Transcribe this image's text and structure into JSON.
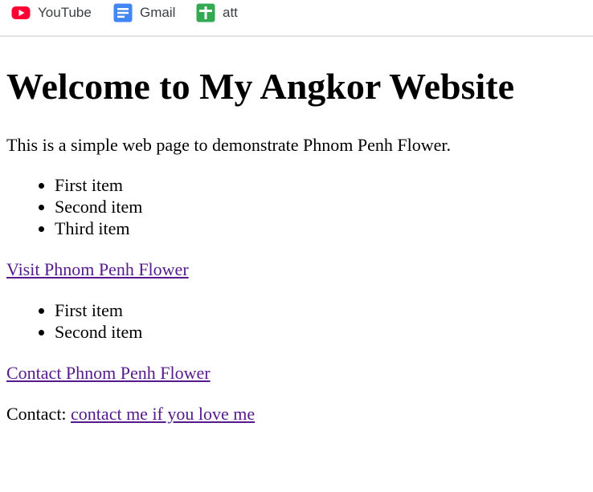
{
  "bookmarks": [
    {
      "label": "YouTube",
      "icon": "youtube-icon",
      "color": "#ff0033"
    },
    {
      "label": "Gmail",
      "icon": "document-icon",
      "color": "#4285f4"
    },
    {
      "label": "att",
      "icon": "plus-icon",
      "color": "#34a853"
    }
  ],
  "page": {
    "heading": "Welcome to My Angkor Website",
    "intro": "This is a simple web page to demonstrate Phnom Penh Flower.",
    "list_one": [
      "First item",
      "Second item",
      "Third item"
    ],
    "link_one": "Visit Phnom Penh Flower",
    "list_two": [
      "First item",
      "Second item"
    ],
    "link_two": "Contact Phnom Penh Flower",
    "contact_label": "Contact:",
    "contact_link": "contact me if you love me"
  },
  "colors": {
    "visited_link": "#551a8b",
    "bookmark_text": "#3c4043"
  }
}
